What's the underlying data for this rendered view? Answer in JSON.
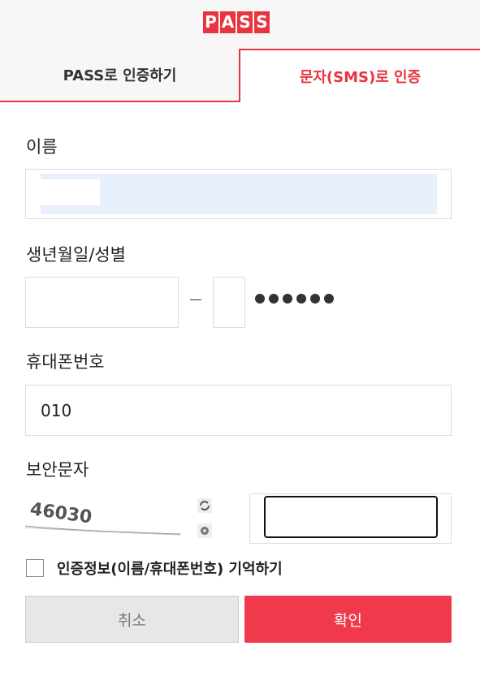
{
  "brand": {
    "logo_letters": [
      "P",
      "A",
      "S",
      "S"
    ],
    "color": "#e8343e"
  },
  "tabs": [
    {
      "label": "PASS로 인증하기",
      "active": false
    },
    {
      "label": "문자(SMS)로 인증",
      "active": true
    }
  ],
  "form": {
    "name": {
      "label": "이름",
      "value": ""
    },
    "birth_gender": {
      "label": "생년월일/성별",
      "birth_value": "",
      "gender_value": "",
      "masked": "●●●●●●"
    },
    "phone": {
      "label": "휴대폰번호",
      "value": "010"
    },
    "captcha": {
      "label": "보안문자",
      "image_text": "46030",
      "refresh_icon": "refresh-icon",
      "audio_icon": "audio-icon",
      "input_value": ""
    }
  },
  "remember": {
    "label": "인증정보(이름/휴대폰번호) 기억하기",
    "checked": false
  },
  "buttons": {
    "cancel": "취소",
    "confirm": "확인"
  },
  "colors": {
    "accent": "#e8343e",
    "confirm_bg": "#f0394b",
    "autofill_bg": "#e8f0fe"
  }
}
